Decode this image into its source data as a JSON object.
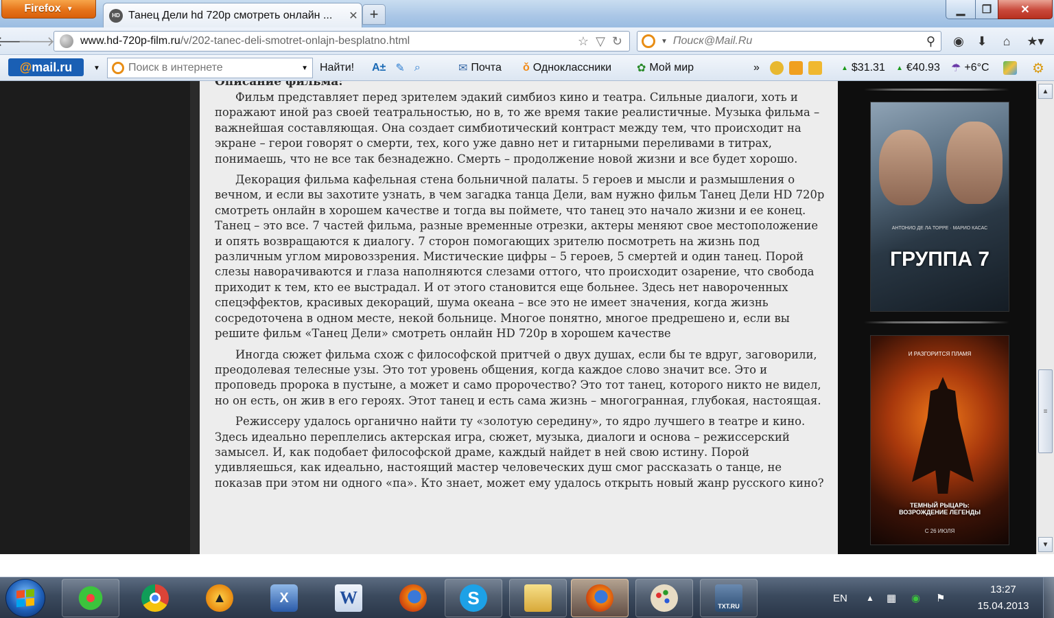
{
  "browser": {
    "app_button": "Firefox",
    "tab_title": "Танец Дели hd 720p смотреть онлайн ...",
    "tab_favicon": "HD",
    "new_tab": "+",
    "url_host": "www.hd-720p-film.ru",
    "url_path": "/v/202-tanec-deli-smotret-onlajn-besplatno.html",
    "search_placeholder": "Поиск@Mail.Ru"
  },
  "mailbar": {
    "logo": "mail.ru",
    "logo_at": "@",
    "search_placeholder": "Поиск в интернете",
    "find_button": "Найти!",
    "mail": "Почта",
    "ok": "Одноклассники",
    "myworld": "Мой мир",
    "more": "»",
    "usd": "$31.31",
    "eur": "€40.93",
    "weather": "+6°C"
  },
  "article": {
    "heading": "Описание фильма:",
    "paragraphs": [
      "Фильм представляет перед зрителем эдакий симбиоз кино и театра. Сильные диалоги, хоть и поражают иной раз своей театральностью, но в, то же время такие реалистичные. Музыка фильма – важнейшая составляющая. Она создает симбиотический контраст между тем, что происходит на экране – герои говорят о смерти, тех, кого уже давно нет и гитарными переливами в титрах, понимаешь, что не все так безнадежно. Смерть – продолжение новой жизни и все будет хорошо.",
      "Декорация фильма кафельная стена больничной палаты. 5 героев и мысли и размышления о вечном, и если вы захотите узнать, в чем загадка танца Дели, вам нужно фильм Танец Дели HD 720p смотреть онлайн в хорошем качестве и тогда вы поймете, что танец это начало жизни и ее конец. Танец – это все. 7 частей фильма, разные временные отрезки, актеры меняют свое местоположение и опять возвращаются к диалогу. 7 сторон помогающих зрителю посмотреть на жизнь под различным углом мировоззрения. Мистические цифры – 5 героев, 5 смертей и один танец. Порой слезы наворачиваются и глаза наполняются слезами оттого, что происходит озарение, что свобода приходит к тем, кто ее выстрадал. И от этого становится еще больнее. Здесь нет навороченных спецэффектов, красивых декораций, шума океана – все это не имеет значения, когда жизнь сосредоточена в одном месте, некой больнице. Многое понятно, многое предрешено и, если вы решите фильм «Танец Дели» смотреть онлайн HD 720p в хорошем качестве",
      "Иногда сюжет фильма схож с философской притчей о двух душах, если бы те вдруг, заговорили, преодолевая телесные узы. Это тот уровень общения, когда каждое слово значит все. Это и проповедь пророка в пустыне, а может и само пророчество? Это тот танец, которого никто не видел, но он есть, он жив в его героях. Этот танец и есть сама жизнь – многогранная, глубокая, настоящая.",
      "Режиссеру удалось органично найти ту «золотую середину», то ядро лучшего в театре и кино. Здесь идеально переплелись актерская игра, сюжет, музыка, диалоги и основа – режиссерский замысел. И, как подобает философской драме, каждый найдет в ней свою истину. Порой удивляешься, как идеально, настоящий мастер человеческих душ смог рассказать о танце, не показав при этом ни одного «па». Кто знает, может ему удалось открыть новый жанр русского кино?"
    ]
  },
  "posters": [
    {
      "title": "ГРУППА 7",
      "subtitle": "АНТОНИО ДЕ ЛА ТОРРЕ · МАРИО КАСАС"
    },
    {
      "title": "ТЕМНЫЙ РЫЦАРЬ: ВОЗРОЖДЕНИЕ ЛЕГЕНДЫ",
      "tagline": "И РАЗГОРИТСЯ ПЛАМЯ",
      "date": "С 26 ИЮЛЯ"
    }
  ],
  "taskbar": {
    "lang": "EN",
    "time": "13:27",
    "date": "15.04.2013",
    "apps": [
      "icq",
      "chrome",
      "aimp",
      "xaml-editor",
      "word",
      "firefox",
      "skype",
      "explorer",
      "firefox-active",
      "paint",
      "txt-ru"
    ],
    "txt_ru_label": "TXT.RU"
  }
}
